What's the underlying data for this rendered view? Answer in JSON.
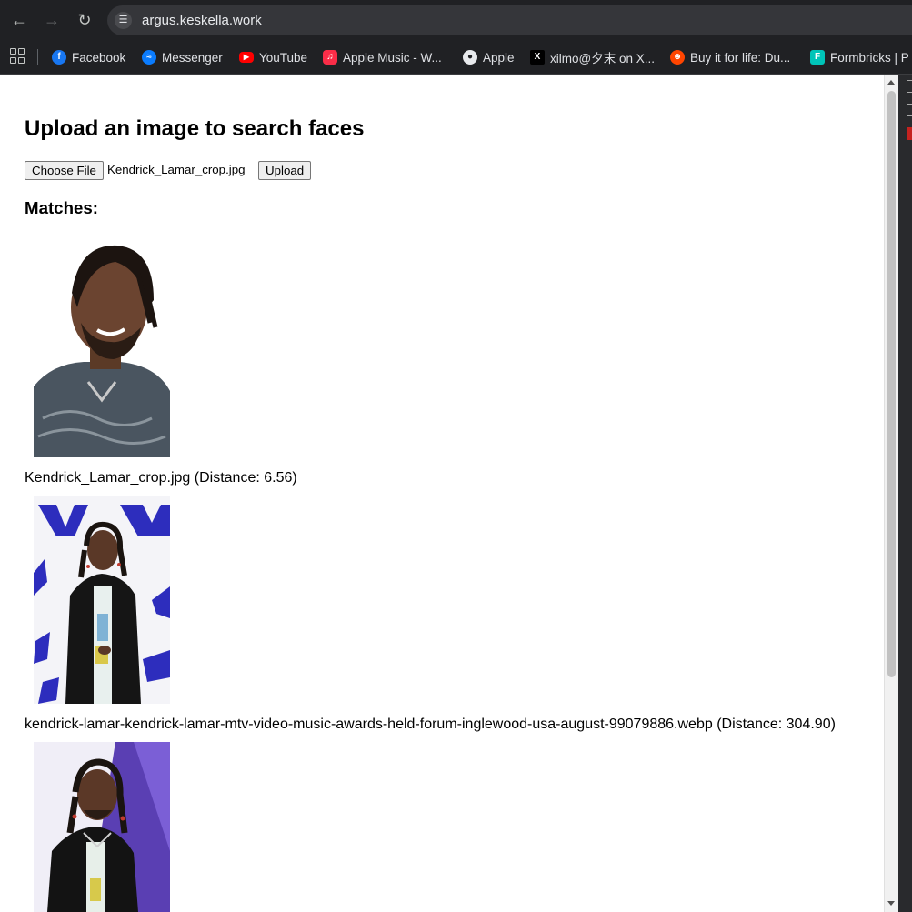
{
  "browser": {
    "url": "argus.keskella.work",
    "bookmarks": [
      {
        "label": "Facebook",
        "icon": "facebook-icon",
        "color": "#1877f2"
      },
      {
        "label": "Messenger",
        "icon": "messenger-icon",
        "color": "#0a7cff"
      },
      {
        "label": "YouTube",
        "icon": "youtube-icon",
        "color": "#ff0000"
      },
      {
        "label": "Apple Music - W...",
        "icon": "apple-music-icon",
        "color": "#fa2d48"
      },
      {
        "label": "Apple",
        "icon": "apple-icon",
        "color": "#e8eaed"
      },
      {
        "label": "xilmo@夕末 on X...",
        "icon": "x-icon",
        "color": "#000000"
      },
      {
        "label": "Buy it for life: Du...",
        "icon": "reddit-icon",
        "color": "#ff4500"
      },
      {
        "label": "Formbricks | P",
        "icon": "formbricks-icon",
        "color": "#00c4b8"
      }
    ]
  },
  "page": {
    "title": "Upload an image to search faces",
    "choose_file_label": "Choose File",
    "selected_file": "Kendrick_Lamar_crop.jpg",
    "upload_label": "Upload",
    "matches_heading": "Matches:",
    "matches": [
      {
        "caption": "Kendrick_Lamar_crop.jpg (Distance: 6.56)",
        "image": "kendrick-portrait-image"
      },
      {
        "caption": "kendrick-lamar-kendrick-lamar-mtv-video-music-awards-held-forum-inglewood-usa-august-99079886.webp (Distance: 304.90)",
        "image": "kendrick-vma-image"
      },
      {
        "caption": "",
        "image": "kendrick-red-carpet-image"
      }
    ]
  }
}
